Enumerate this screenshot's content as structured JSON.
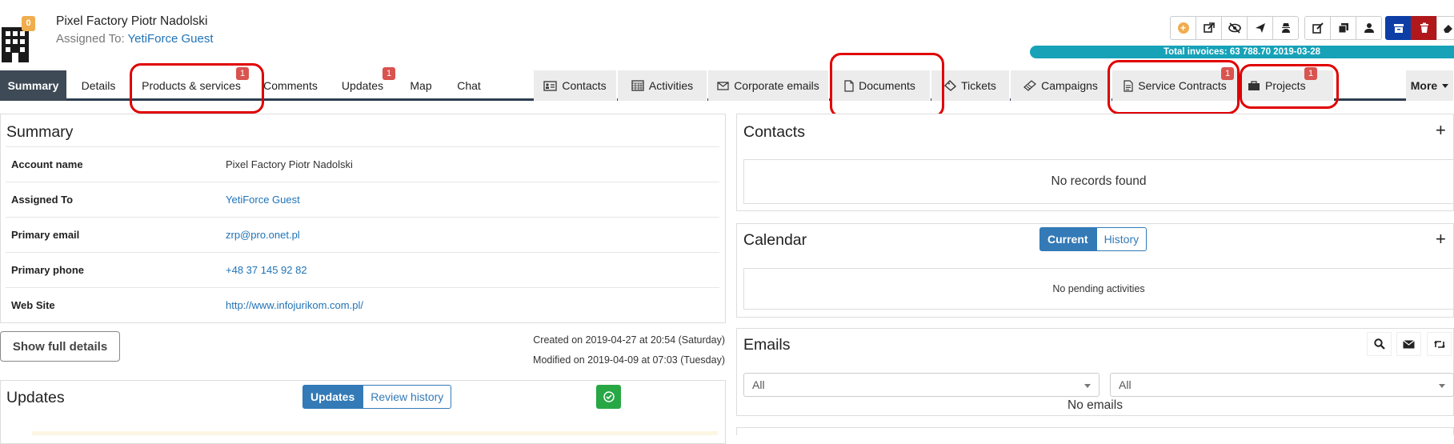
{
  "header": {
    "account_name": "Pixel Factory Piotr Nadolski",
    "assigned_prefix": "Assigned To:",
    "assigned_user": "YetiForce Guest",
    "badge_count": "0",
    "total_invoices": "Total invoices: 63 788.70 2019-03-28"
  },
  "toolbar": {
    "icons": [
      "add-icon",
      "external-link-icon",
      "eye-slash-icon",
      "send-icon",
      "user-secret-icon",
      "edit-icon",
      "copy-icon",
      "user-icon",
      "archive-icon",
      "trash-icon",
      "eraser-icon"
    ],
    "colors": {
      "yellow": "#f0ad4e",
      "blue": "#0d3ea6",
      "red": "#b0181c"
    }
  },
  "tabs": {
    "summary": "Summary",
    "details": "Details",
    "products": "Products & services",
    "products_count": "1",
    "comments": "Comments",
    "updates": "Updates",
    "updates_count": "1",
    "map": "Map",
    "chat": "Chat",
    "contacts": "Contacts",
    "activities": "Activities",
    "corporate_emails": "Corporate emails",
    "documents": "Documents",
    "tickets": "Tickets",
    "campaigns": "Campaigns",
    "service_contracts": "Service Contracts",
    "service_contracts_count": "1",
    "projects": "Projects",
    "projects_count": "1",
    "more": "More"
  },
  "summary": {
    "title": "Summary",
    "fields": [
      {
        "label": "Account name",
        "value": "Pixel Factory Piotr Nadolski"
      },
      {
        "label": "Assigned To",
        "value": "YetiForce Guest"
      },
      {
        "label": "Primary email",
        "value": "zrp@pro.onet.pl"
      },
      {
        "label": "Primary phone",
        "value": "+48 37 145 92 82"
      },
      {
        "label": "Web Site",
        "value": "http://www.infojurikom.com.pl/"
      }
    ],
    "show_full_details": "Show full details",
    "created": "Created on 2019-04-27 at 20:54 (Saturday)",
    "modified": "Modified on 2019-04-09 at 07:03 (Tuesday)"
  },
  "updates_panel": {
    "title": "Updates",
    "btn_updates": "Updates",
    "btn_review": "Review history"
  },
  "contacts_panel": {
    "title": "Contacts",
    "empty": "No records found"
  },
  "calendar_panel": {
    "title": "Calendar",
    "btn_current": "Current",
    "btn_history": "History",
    "empty": "No pending activities"
  },
  "emails_panel": {
    "title": "Emails",
    "filter1": "All",
    "filter2": "All",
    "empty": "No emails"
  }
}
